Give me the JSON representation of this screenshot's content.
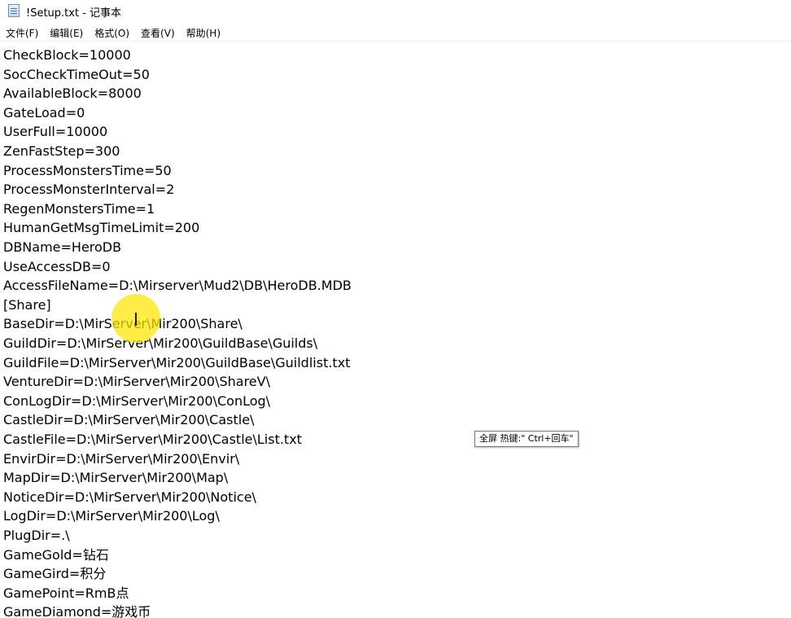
{
  "window": {
    "title": "!Setup.txt - 记事本"
  },
  "menubar": {
    "items": [
      "文件(F)",
      "编辑(E)",
      "格式(O)",
      "查看(V)",
      "帮助(H)"
    ]
  },
  "editor": {
    "lines": [
      "CheckBlock=10000",
      "SocCheckTimeOut=50",
      "AvailableBlock=8000",
      "GateLoad=0",
      "UserFull=10000",
      "ZenFastStep=300",
      "ProcessMonstersTime=50",
      "ProcessMonsterInterval=2",
      "RegenMonstersTime=1",
      "HumanGetMsgTimeLimit=200",
      "DBName=HeroDB",
      "UseAccessDB=0",
      "AccessFileName=D:\\Mirserver\\Mud2\\DB\\HeroDB.MDB",
      "[Share]",
      "BaseDir=D:\\MirServer\\Mir200\\Share\\",
      "GuildDir=D:\\MirServer\\Mir200\\GuildBase\\Guilds\\",
      "GuildFile=D:\\MirServer\\Mir200\\GuildBase\\Guildlist.txt",
      "VentureDir=D:\\MirServer\\Mir200\\ShareV\\",
      "ConLogDir=D:\\MirServer\\Mir200\\ConLog\\",
      "CastleDir=D:\\MirServer\\Mir200\\Castle\\",
      "CastleFile=D:\\MirServer\\Mir200\\Castle\\List.txt",
      "EnvirDir=D:\\MirServer\\Mir200\\Envir\\",
      "MapDir=D:\\MirServer\\Mir200\\Map\\",
      "NoticeDir=D:\\MirServer\\Mir200\\Notice\\",
      "LogDir=D:\\MirServer\\Mir200\\Log\\",
      "PlugDir=.\\",
      "GameGold=钻石",
      "GameGird=积分",
      "GamePoint=RmB点",
      "GameDiamond=游戏币"
    ]
  },
  "tooltip": {
    "text": "全屏 热键:\" Ctrl+回车\""
  },
  "colors": {
    "cursor_highlight": "#ffe600",
    "background": "#ffffff",
    "text": "#000000"
  }
}
